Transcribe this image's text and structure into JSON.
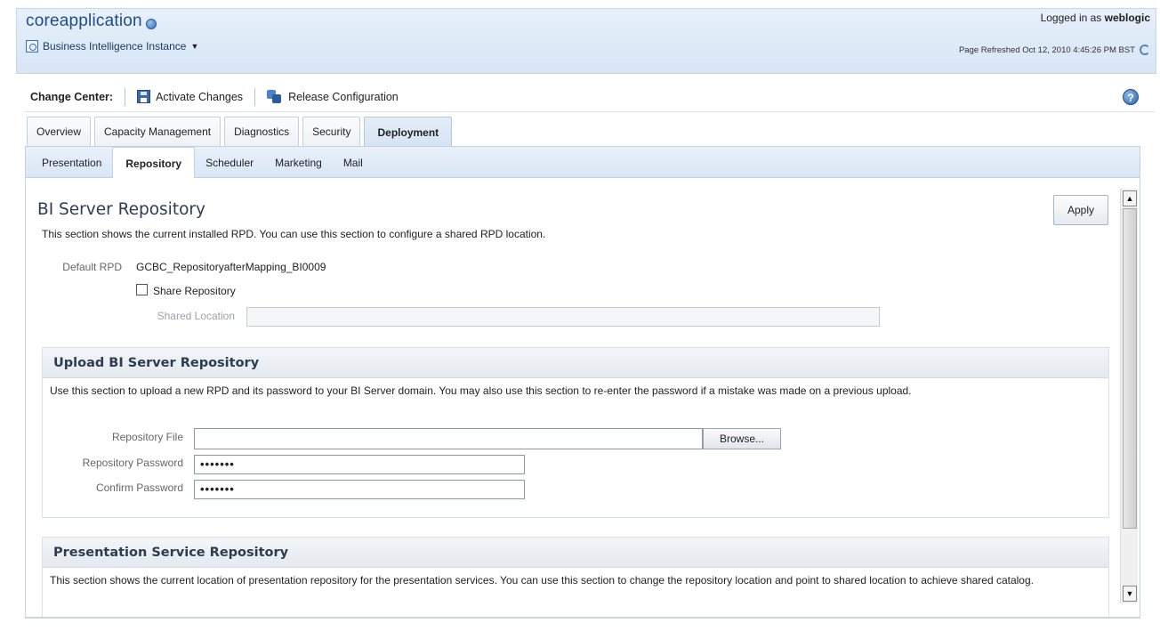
{
  "header": {
    "app_title": "coreapplication",
    "instance_menu": "Business Intelligence Instance",
    "login_prefix": "Logged in as",
    "login_user": "weblogic",
    "page_refreshed": "Page Refreshed Oct 12, 2010 4:45:26 PM BST"
  },
  "change_center": {
    "label": "Change Center:",
    "activate": "Activate Changes",
    "release": "Release Configuration",
    "help": "?"
  },
  "tabs": [
    "Overview",
    "Capacity Management",
    "Diagnostics",
    "Security",
    "Deployment"
  ],
  "active_tab": "Deployment",
  "subtabs": [
    "Presentation",
    "Repository",
    "Scheduler",
    "Marketing",
    "Mail"
  ],
  "active_subtab": "Repository",
  "bi_server_repository": {
    "title": "BI Server Repository",
    "description": "This section shows the current installed RPD. You can use this section to configure a shared RPD location.",
    "apply": "Apply",
    "default_rpd_label": "Default RPD",
    "default_rpd_value": "GCBC_RepositoryafterMapping_BI0009",
    "share_repository_label": "Share Repository",
    "share_repository_checked": false,
    "shared_location_label": "Shared Location",
    "shared_location_value": ""
  },
  "upload_section": {
    "title": "Upload BI Server Repository",
    "description": "Use this section to upload a new RPD and its password to your BI Server domain. You may also use this section to re-enter the password if a mistake was made on a previous upload.",
    "repository_file_label": "Repository File",
    "repository_file_value": "",
    "browse": "Browse...",
    "repository_password_label": "Repository Password",
    "repository_password_value": "•••••••",
    "confirm_password_label": "Confirm Password",
    "confirm_password_value": "•••••••"
  },
  "presentation_section": {
    "title": "Presentation Service Repository",
    "description": "This section shows the current location of presentation repository for the presentation services. You can use this section to change the repository location and point to shared location to achieve shared catalog."
  },
  "scrollbar": {
    "up": "▲",
    "down": "▼"
  }
}
